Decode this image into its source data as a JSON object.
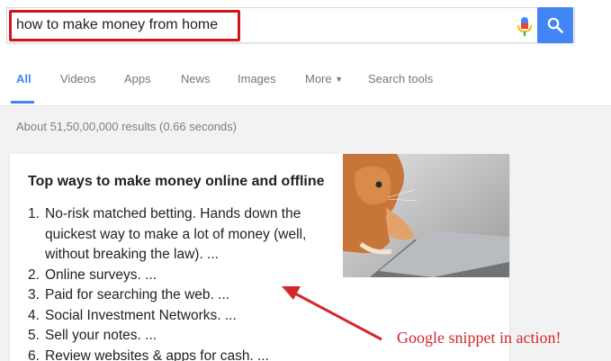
{
  "search": {
    "query": "how to make money from home"
  },
  "tabs": [
    {
      "label": "All"
    },
    {
      "label": "Videos"
    },
    {
      "label": "Apps"
    },
    {
      "label": "News"
    },
    {
      "label": "Images"
    },
    {
      "label": "More"
    },
    {
      "label": "Search tools"
    }
  ],
  "results": {
    "stats": "About 51,50,00,000 results (0.66 seconds)"
  },
  "snippet": {
    "title": "Top ways to make money online and offline",
    "items": [
      {
        "num": "1.",
        "text": "No-risk matched betting. Hands down the quickest way to make a lot of money (well, without breaking the law). ..."
      },
      {
        "num": "2.",
        "text": "Online surveys. ..."
      },
      {
        "num": "3.",
        "text": "Paid for searching the web. ..."
      },
      {
        "num": "4.",
        "text": "Social Investment Networks. ..."
      },
      {
        "num": "5.",
        "text": "Sell your notes. ..."
      },
      {
        "num": "6.",
        "text": "Review websites & apps for cash. ..."
      }
    ],
    "image_icon": "cat-on-laptop-image"
  },
  "annotation": {
    "text": "Google snippet in action!",
    "color": "#d3282c"
  },
  "colors": {
    "accent": "#4285f4",
    "highlight": "#d0141b"
  }
}
